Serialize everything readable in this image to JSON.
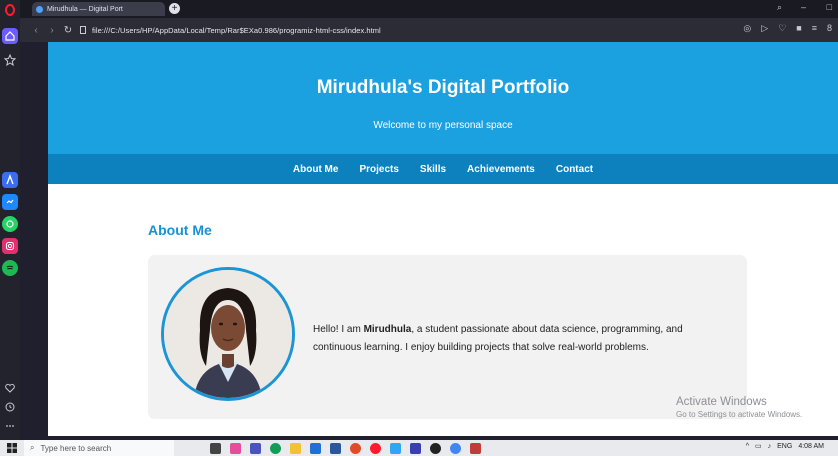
{
  "browser": {
    "tab_title": "Mirudhula — Digital Port",
    "new_tab": "+",
    "url": "file:///C:/Users/HP/AppData/Local/Temp/Rar$EXa0.986/programiz-html-css/index.html"
  },
  "page": {
    "title": "Mirudhula's Digital Portfolio",
    "subtitle": "Welcome to my personal space",
    "nav": [
      {
        "label": "About Me"
      },
      {
        "label": "Projects"
      },
      {
        "label": "Skills"
      },
      {
        "label": "Achievements"
      },
      {
        "label": "Contact"
      }
    ],
    "section_title": "About Me",
    "about_before": "Hello! I am ",
    "about_name": "Mirudhula",
    "about_after": ", a student passionate about data science, programming, and continuous learning. I enjoy building projects that solve real-world problems."
  },
  "watermark": {
    "line1": "Activate Windows",
    "line2": "Go to Settings to activate Windows."
  },
  "taskbar": {
    "search_placeholder": "Type here to search",
    "language": "ENG",
    "time": "4:08 AM"
  },
  "colors": {
    "hero": "#1ba0e0",
    "nav": "#0d81bd",
    "accent": "#1791d4"
  }
}
